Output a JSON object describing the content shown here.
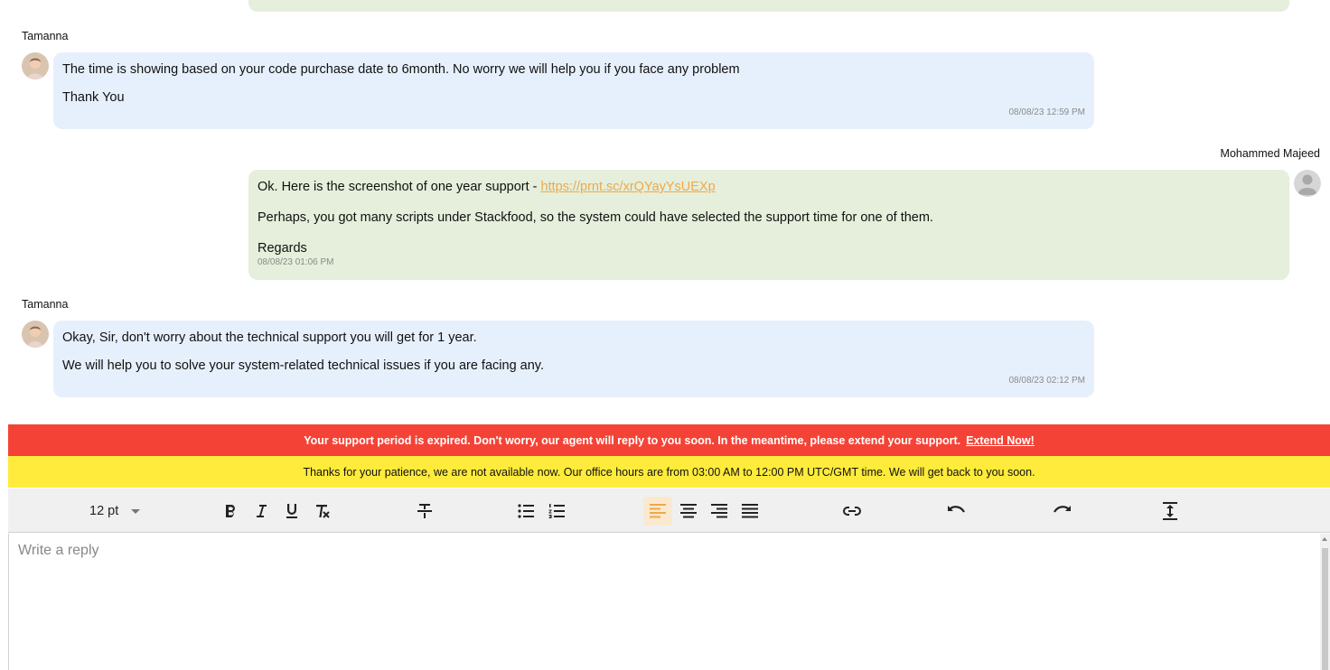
{
  "conversation": {
    "messages": [
      {
        "sender": "Tamanna",
        "role": "agent",
        "lines": [
          "The time is showing based on your code purchase date to 6month. No worry we will help you if you face any problem",
          "Thank You"
        ],
        "timestamp": "08/08/23 12:59 PM"
      },
      {
        "sender": "Mohammed Majeed",
        "role": "user",
        "line1_prefix": "Ok. Here is the screenshot of one year support - ",
        "line1_link": "https://prnt.sc/xrQYayYsUEXp",
        "lines": [
          "Perhaps, you got many scripts under Stackfood, so the system could have selected the support time for one of them.",
          "Regards"
        ],
        "timestamp": "08/08/23 01:06 PM"
      },
      {
        "sender": "Tamanna",
        "role": "agent",
        "lines": [
          "Okay, Sir, don't worry about the technical support you will get for 1 year.",
          "We will help you to solve your system-related technical issues if you are facing any."
        ],
        "timestamp": "08/08/23 02:12 PM"
      }
    ]
  },
  "banners": {
    "expired_text": "Your support period is expired. Don't worry, our agent will reply to you soon. In the meantime, please extend your support.",
    "extend_link": "Extend Now!",
    "office_hours_text": "Thanks for your patience, we are not available now. Our office hours are from 03:00 AM to 12:00 PM UTC/GMT time. We will get back to you soon."
  },
  "editor": {
    "font_size": "12 pt",
    "placeholder": "Write a reply",
    "toolbar_icons": [
      "bold-icon",
      "italic-icon",
      "underline-icon",
      "clear-format-icon",
      "strikethrough-icon",
      "bullet-list-icon",
      "numbered-list-icon",
      "align-left-icon",
      "align-center-icon",
      "align-right-icon",
      "align-justify-icon",
      "link-icon",
      "undo-icon",
      "redo-icon",
      "line-height-icon"
    ],
    "active_alignment": "left"
  },
  "colors": {
    "agent_bubble": "#e6f0fd",
    "user_bubble": "#e5efdb",
    "expired_banner": "#f44336",
    "office_banner": "#ffeb3b",
    "link": "#f0a84a",
    "active_tool": "#fbe9cf"
  }
}
